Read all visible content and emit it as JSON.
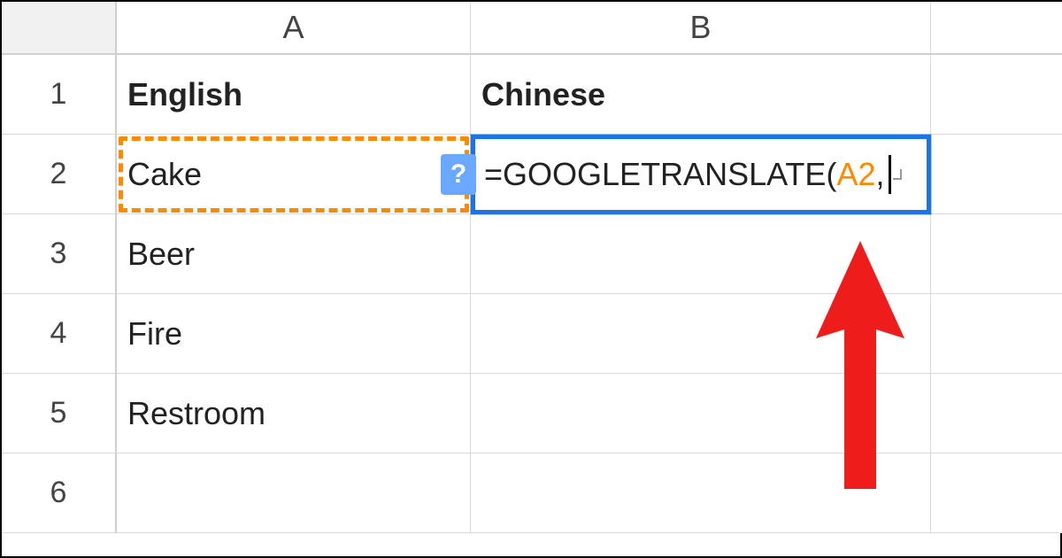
{
  "columns": {
    "A": "A",
    "B": "B"
  },
  "rows": {
    "r1": "1",
    "r2": "2",
    "r3": "3",
    "r4": "4",
    "r5": "5",
    "r6": "6"
  },
  "cells": {
    "A1": "English",
    "B1": "Chinese",
    "A2": "Cake",
    "A3": "Beer",
    "A4": "Fire",
    "A5": "Restroom"
  },
  "formula_edit": {
    "prefix": "=GOOGLETRANSLATE(",
    "ref": "A2",
    "suffix": ",",
    "help_badge": "?"
  },
  "chart_data": {
    "type": "table",
    "columns": [
      "English",
      "Chinese"
    ],
    "rows": [
      [
        "Cake",
        "=GOOGLETRANSLATE(A2,"
      ],
      [
        "Beer",
        ""
      ],
      [
        "Fire",
        ""
      ],
      [
        "Restroom",
        ""
      ]
    ]
  }
}
